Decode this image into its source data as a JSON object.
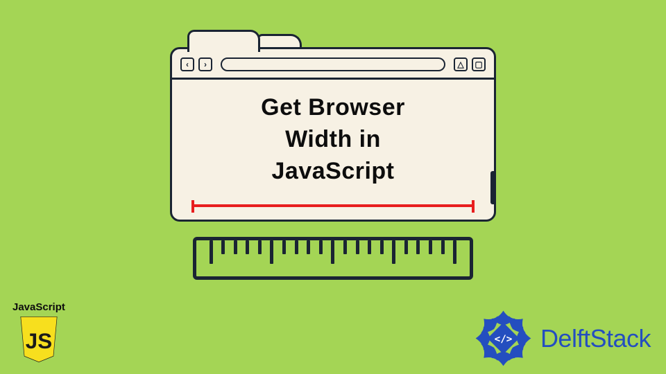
{
  "title": {
    "line1": "Get Browser",
    "line2": "Width in",
    "line3": "JavaScript"
  },
  "browser_toolbar": {
    "back_glyph": "‹",
    "forward_glyph": "›",
    "up_glyph": "△",
    "close_glyph": "▢"
  },
  "ruler": {
    "pattern": [
      "long",
      "short",
      "short",
      "short",
      "short",
      "long",
      "short",
      "short",
      "short",
      "short",
      "long",
      "short",
      "short",
      "short",
      "short",
      "long",
      "short",
      "short",
      "short",
      "short",
      "long"
    ]
  },
  "js_badge": {
    "label": "JavaScript",
    "initials": "JS"
  },
  "delftstack": {
    "text": "DelftStack",
    "diamond_glyph": "</>"
  },
  "colors": {
    "bg": "#a4d555",
    "ink": "#1a2433",
    "cream": "#f7f1e4",
    "red": "#e81e1e",
    "js_yellow": "#f7df1e",
    "ds_blue": "#244ebf"
  }
}
